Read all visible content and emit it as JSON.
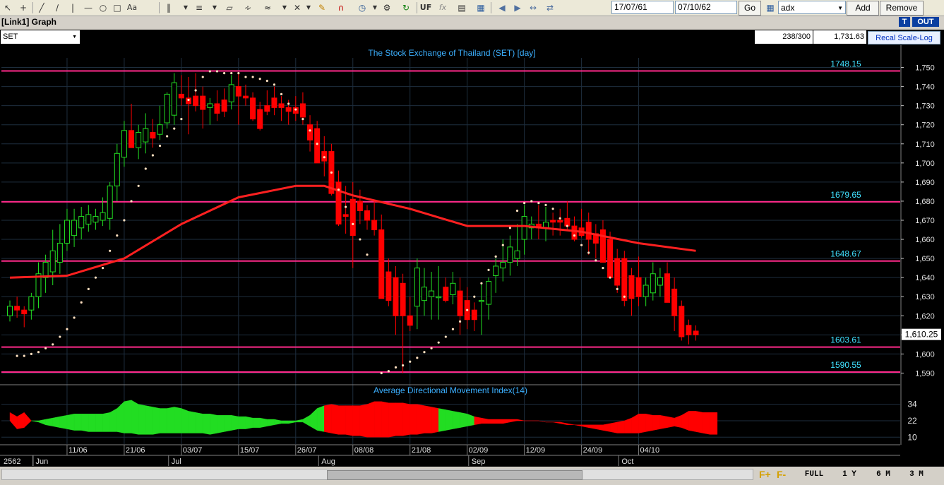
{
  "toolbar": {
    "date_from": "17/07/61",
    "date_to": "07/10/62",
    "go_label": "Go",
    "indicator_value": "adx",
    "add_label": "Add",
    "remove_label": "Remove",
    "uf_label": "UF",
    "fx_label": "fx"
  },
  "window": {
    "title": "[Link1] Graph",
    "t_label": "T",
    "out_label": "OUT"
  },
  "infobar": {
    "symbol": "SET",
    "bar_count": "238/300",
    "price_value": "1,731.63",
    "recal_label": "Recal Scale-Log"
  },
  "bottombar": {
    "f_plus": "F+",
    "f_minus": "F-",
    "full_label": "FULL",
    "one_year_label": "1 Y",
    "six_month_label": "6 M",
    "three_month_label": "3 M",
    "scroll_position": 0.66
  },
  "colors": {
    "background": "#000000",
    "grid": "#1e2e3e",
    "bull": "#22dd22",
    "bear": "#ff0000",
    "ma_line": "#ff2020",
    "level_line": "#ff2a8a",
    "level_label": "#40e0ff",
    "title": "#3cb0ff",
    "sar_dot": "#ffe0c0"
  },
  "chart_data": [
    {
      "type": "candlestick",
      "title": "The Stock Exchange of Thailand (SET) [day]",
      "ylim": [
        1585,
        1755
      ],
      "y_ticks": [
        "1,590",
        "1,600",
        "1,610",
        "1,620",
        "1,630",
        "1,640",
        "1,650",
        "1,660",
        "1,670",
        "1,680",
        "1,690",
        "1,700",
        "1,710",
        "1,720",
        "1,730",
        "1,740",
        "1,750"
      ],
      "x_tick_labels": [
        "11/06",
        "21/06",
        "03/07",
        "15/07",
        "26/07",
        "08/08",
        "21/08",
        "02/09",
        "12/09",
        "24/09",
        "04/10"
      ],
      "x_tick_index": [
        8,
        16,
        24,
        32,
        40,
        48,
        56,
        64,
        72,
        80,
        88
      ],
      "month_labels": [
        "2562",
        "Jun",
        "Jul",
        "Aug",
        "Sep",
        "Oct"
      ],
      "month_index": [
        0,
        4,
        23,
        44,
        65,
        86
      ],
      "horizontal_levels": [
        1748.15,
        1679.65,
        1648.67,
        1603.61,
        1590.55
      ],
      "horizontal_level_labels": [
        "1748.15",
        "1679.65",
        "1648.67",
        "1603.61",
        "1590.55"
      ],
      "last_price": 1610.25,
      "last_price_label": "1,610.25",
      "candles": [
        [
          1620,
          1628,
          1617,
          1625
        ],
        [
          1625,
          1630,
          1619,
          1623
        ],
        [
          1623,
          1625,
          1614,
          1621
        ],
        [
          1623,
          1632,
          1618,
          1630
        ],
        [
          1630,
          1648,
          1624,
          1642
        ],
        [
          1640,
          1652,
          1632,
          1648
        ],
        [
          1643,
          1665,
          1636,
          1654
        ],
        [
          1648,
          1668,
          1642,
          1658
        ],
        [
          1658,
          1676,
          1654,
          1670
        ],
        [
          1662,
          1676,
          1656,
          1670
        ],
        [
          1666,
          1677,
          1660,
          1672
        ],
        [
          1668,
          1678,
          1664,
          1673
        ],
        [
          1669,
          1676,
          1665,
          1672
        ],
        [
          1670,
          1682,
          1667,
          1674
        ],
        [
          1671,
          1690,
          1665,
          1688
        ],
        [
          1688,
          1710,
          1680,
          1705
        ],
        [
          1703,
          1722,
          1698,
          1717
        ],
        [
          1717,
          1731,
          1710,
          1708
        ],
        [
          1708,
          1720,
          1702,
          1716
        ],
        [
          1711,
          1726,
          1705,
          1718
        ],
        [
          1716,
          1723,
          1708,
          1713
        ],
        [
          1715,
          1730,
          1712,
          1720
        ],
        [
          1721,
          1737,
          1718,
          1736
        ],
        [
          1725,
          1747,
          1720,
          1742
        ],
        [
          1736,
          1746,
          1730,
          1734
        ],
        [
          1734,
          1745,
          1715,
          1731
        ],
        [
          1735,
          1747,
          1727,
          1730
        ],
        [
          1735,
          1740,
          1718,
          1728
        ],
        [
          1729,
          1734,
          1720,
          1731
        ],
        [
          1731,
          1738,
          1722,
          1726
        ],
        [
          1733,
          1739,
          1724,
          1727
        ],
        [
          1732,
          1746,
          1728,
          1741
        ],
        [
          1740,
          1747,
          1720,
          1735
        ],
        [
          1735,
          1741,
          1730,
          1734
        ],
        [
          1734,
          1737,
          1722,
          1723
        ],
        [
          1728,
          1732,
          1717,
          1718
        ],
        [
          1730,
          1738,
          1725,
          1727
        ],
        [
          1734,
          1740,
          1725,
          1729
        ],
        [
          1731,
          1735,
          1722,
          1729
        ],
        [
          1729,
          1733,
          1720,
          1727
        ],
        [
          1729,
          1735,
          1722,
          1726
        ],
        [
          1731,
          1737,
          1720,
          1724
        ],
        [
          1720,
          1725,
          1706,
          1712
        ],
        [
          1718,
          1722,
          1701,
          1700
        ],
        [
          1706,
          1714,
          1693,
          1701
        ],
        [
          1706,
          1710,
          1683,
          1684
        ],
        [
          1690,
          1696,
          1667,
          1668
        ],
        [
          1673,
          1688,
          1663,
          1672
        ],
        [
          1681,
          1690,
          1645,
          1662
        ],
        [
          1680,
          1686,
          1668,
          1675
        ],
        [
          1675,
          1678,
          1665,
          1670
        ],
        [
          1670,
          1680,
          1662,
          1665
        ],
        [
          1665,
          1673,
          1640,
          1629
        ],
        [
          1643,
          1650,
          1625,
          1628
        ],
        [
          1640,
          1646,
          1610,
          1620
        ],
        [
          1637,
          1642,
          1590,
          1620
        ],
        [
          1620,
          1630,
          1612,
          1615
        ],
        [
          1625,
          1650,
          1613,
          1645
        ],
        [
          1628,
          1645,
          1620,
          1635
        ],
        [
          1630,
          1643,
          1618,
          1633
        ],
        [
          1630,
          1646,
          1618,
          1630
        ],
        [
          1635,
          1640,
          1627,
          1628
        ],
        [
          1631,
          1643,
          1626,
          1637
        ],
        [
          1633,
          1640,
          1610,
          1620
        ],
        [
          1628,
          1635,
          1613,
          1618
        ],
        [
          1623,
          1627,
          1612,
          1618
        ],
        [
          1628,
          1637,
          1610,
          1628
        ],
        [
          1626,
          1640,
          1618,
          1638
        ],
        [
          1641,
          1650,
          1632,
          1646
        ],
        [
          1645,
          1660,
          1638,
          1648
        ],
        [
          1648,
          1662,
          1641,
          1656
        ],
        [
          1650,
          1668,
          1646,
          1654
        ],
        [
          1660,
          1678,
          1652,
          1672
        ],
        [
          1666,
          1672,
          1660,
          1668
        ],
        [
          1668,
          1678,
          1660,
          1666
        ],
        [
          1666,
          1677,
          1659,
          1669
        ],
        [
          1670,
          1674,
          1662,
          1669
        ],
        [
          1670,
          1676,
          1662,
          1669
        ],
        [
          1671,
          1680,
          1665,
          1667
        ],
        [
          1667,
          1672,
          1659,
          1660
        ],
        [
          1666,
          1676,
          1661,
          1662
        ],
        [
          1669,
          1674,
          1652,
          1660
        ],
        [
          1663,
          1668,
          1650,
          1658
        ],
        [
          1665,
          1670,
          1648,
          1648
        ],
        [
          1660,
          1664,
          1642,
          1640
        ],
        [
          1650,
          1655,
          1632,
          1636
        ],
        [
          1650,
          1654,
          1625,
          1628
        ],
        [
          1641,
          1645,
          1620,
          1629
        ],
        [
          1640,
          1651,
          1625,
          1630
        ],
        [
          1630,
          1640,
          1625,
          1636
        ],
        [
          1632,
          1648,
          1628,
          1642
        ],
        [
          1636,
          1645,
          1630,
          1640
        ],
        [
          1642,
          1648,
          1630,
          1627
        ],
        [
          1634,
          1640,
          1612,
          1620
        ],
        [
          1625,
          1628,
          1607,
          1609
        ],
        [
          1615,
          1618,
          1605,
          1610
        ],
        [
          1612,
          1615,
          1607,
          1610
        ]
      ],
      "moving_average": [
        [
          0,
          1640
        ],
        [
          8,
          1641
        ],
        [
          16,
          1650
        ],
        [
          24,
          1668
        ],
        [
          32,
          1682
        ],
        [
          40,
          1688
        ],
        [
          44,
          1688
        ],
        [
          48,
          1683
        ],
        [
          56,
          1676
        ],
        [
          64,
          1667
        ],
        [
          72,
          1667
        ],
        [
          80,
          1664
        ],
        [
          88,
          1658
        ],
        [
          96,
          1654
        ]
      ],
      "parabolic_sar": [
        [
          1,
          1599
        ],
        [
          2,
          1599
        ],
        [
          3,
          1600
        ],
        [
          4,
          1601
        ],
        [
          5,
          1603
        ],
        [
          6,
          1605
        ],
        [
          7,
          1609
        ],
        [
          8,
          1613
        ],
        [
          9,
          1619
        ],
        [
          10,
          1627
        ],
        [
          11,
          1634
        ],
        [
          12,
          1640
        ],
        [
          13,
          1645
        ],
        [
          14,
          1654
        ],
        [
          15,
          1662
        ],
        [
          16,
          1670
        ],
        [
          17,
          1680
        ],
        [
          18,
          1688
        ],
        [
          19,
          1697
        ],
        [
          20,
          1704
        ],
        [
          21,
          1709
        ],
        [
          22,
          1714
        ],
        [
          23,
          1718
        ],
        [
          24,
          1723
        ],
        [
          25,
          1733
        ],
        [
          26,
          1738
        ],
        [
          27,
          1745
        ],
        [
          28,
          1748
        ],
        [
          29,
          1748
        ],
        [
          30,
          1747
        ],
        [
          31,
          1747
        ],
        [
          32,
          1747
        ],
        [
          33,
          1745
        ],
        [
          34,
          1745
        ],
        [
          35,
          1744
        ],
        [
          36,
          1743
        ],
        [
          37,
          1741
        ],
        [
          38,
          1736
        ],
        [
          39,
          1731
        ],
        [
          40,
          1728
        ],
        [
          41,
          1723
        ],
        [
          42,
          1717
        ],
        [
          43,
          1710
        ],
        [
          44,
          1703
        ],
        [
          45,
          1695
        ],
        [
          46,
          1686
        ],
        [
          47,
          1677
        ],
        [
          48,
          1668
        ],
        [
          49,
          1660
        ],
        [
          50,
          1652
        ],
        [
          52,
          1590
        ],
        [
          53,
          1591
        ],
        [
          54,
          1593
        ],
        [
          55,
          1594
        ],
        [
          56,
          1596
        ],
        [
          57,
          1598
        ],
        [
          58,
          1601
        ],
        [
          59,
          1603
        ],
        [
          60,
          1606
        ],
        [
          61,
          1609
        ],
        [
          62,
          1613
        ],
        [
          63,
          1617
        ],
        [
          64,
          1623
        ],
        [
          65,
          1630
        ],
        [
          66,
          1637
        ],
        [
          67,
          1644
        ],
        [
          68,
          1651
        ],
        [
          69,
          1657
        ],
        [
          70,
          1666
        ],
        [
          71,
          1675
        ],
        [
          72,
          1679
        ],
        [
          73,
          1680
        ],
        [
          74,
          1679
        ],
        [
          75,
          1678
        ],
        [
          76,
          1676
        ],
        [
          77,
          1671
        ],
        [
          78,
          1667
        ],
        [
          79,
          1662
        ],
        [
          80,
          1657
        ],
        [
          81,
          1653
        ],
        [
          82,
          1649
        ],
        [
          83,
          1645
        ],
        [
          84,
          1640
        ],
        [
          85,
          1634
        ],
        [
          86,
          1630
        ]
      ]
    },
    {
      "type": "area",
      "title": "Average Directional Movement Index(14)",
      "ylim": [
        5,
        40
      ],
      "y_ticks": [
        "10",
        "22",
        "34"
      ],
      "y_tick_values": [
        10,
        22,
        34
      ],
      "series": [
        {
          "role": "upper",
          "values": [
            28,
            25,
            28,
            22,
            22,
            23,
            24,
            25,
            26,
            27,
            27,
            27,
            27,
            27,
            28,
            31,
            36,
            37,
            34,
            33,
            32,
            31,
            31,
            32,
            31,
            29,
            28,
            27,
            27,
            26,
            26,
            26,
            25,
            25,
            24,
            24,
            23,
            23,
            22,
            22,
            22,
            23,
            26,
            31,
            33,
            34,
            33,
            33,
            33,
            33,
            34,
            36,
            36,
            35,
            35,
            35,
            34,
            34,
            33,
            32,
            31,
            30,
            29,
            28,
            27,
            25,
            24,
            23,
            23,
            23,
            23,
            23,
            22,
            22,
            22,
            21,
            21,
            21,
            20,
            19,
            19,
            19,
            19,
            19,
            20,
            21,
            22,
            24,
            27,
            27,
            26,
            26,
            25,
            24,
            26,
            29,
            29,
            28,
            28,
            28
          ]
        },
        {
          "role": "lower",
          "values": [
            22,
            16,
            17,
            22,
            21,
            19,
            18,
            17,
            16,
            15,
            15,
            14,
            14,
            14,
            14,
            14,
            13,
            13,
            12,
            12,
            12,
            13,
            13,
            13,
            13,
            13,
            13,
            13,
            12,
            13,
            14,
            15,
            16,
            16,
            17,
            17,
            18,
            19,
            20,
            20,
            21,
            21,
            18,
            15,
            14,
            13,
            12,
            12,
            11,
            11,
            10,
            10,
            10,
            10,
            11,
            11,
            12,
            12,
            13,
            13,
            14,
            15,
            16,
            17,
            18,
            19,
            20,
            20,
            20,
            20,
            21,
            22,
            22,
            22,
            22,
            21,
            21,
            20,
            19,
            19,
            18,
            17,
            16,
            15,
            14,
            13,
            13,
            13,
            13,
            14,
            15,
            16,
            17,
            18,
            17,
            15,
            14,
            13,
            12,
            12
          ]
        }
      ]
    }
  ]
}
